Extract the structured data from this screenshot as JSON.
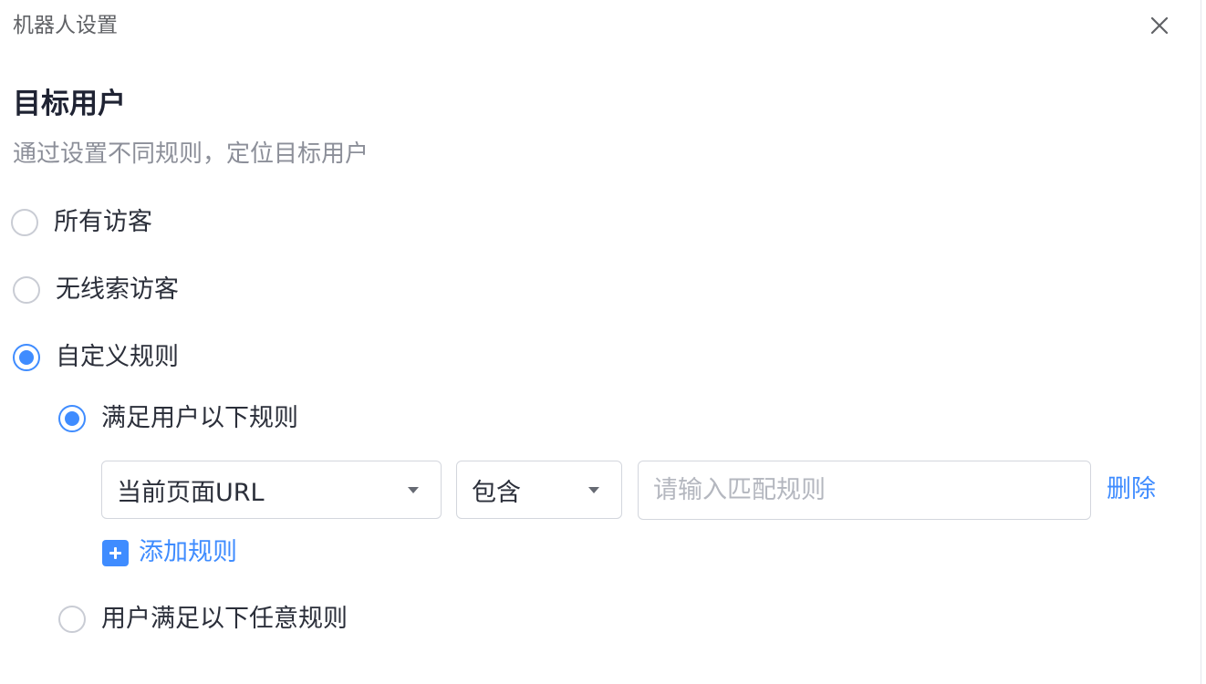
{
  "window": {
    "title": "机器人设置",
    "close_icon": "close-icon"
  },
  "section": {
    "title": "目标用户",
    "description": "通过设置不同规则，定位目标用户"
  },
  "audience_options": [
    {
      "label": "所有访客",
      "checked": false
    },
    {
      "label": "无线索访客",
      "checked": false
    },
    {
      "label": "自定义规则",
      "checked": true
    }
  ],
  "custom_rule_modes": [
    {
      "label": "满足用户以下规则",
      "checked": true
    },
    {
      "label": "用户满足以下任意规则",
      "checked": false
    }
  ],
  "rule": {
    "field_value": "当前页面URL",
    "operator_value": "包含",
    "input_placeholder": "请输入匹配规则",
    "input_value": "",
    "delete_label": "删除"
  },
  "add_rule": {
    "label": "添加规则",
    "icon": "plus-square-icon"
  },
  "colors": {
    "accent": "#3f8cff",
    "title_text": "#1f2333",
    "muted_text": "#8c8f99",
    "border": "#d3d6dd"
  }
}
